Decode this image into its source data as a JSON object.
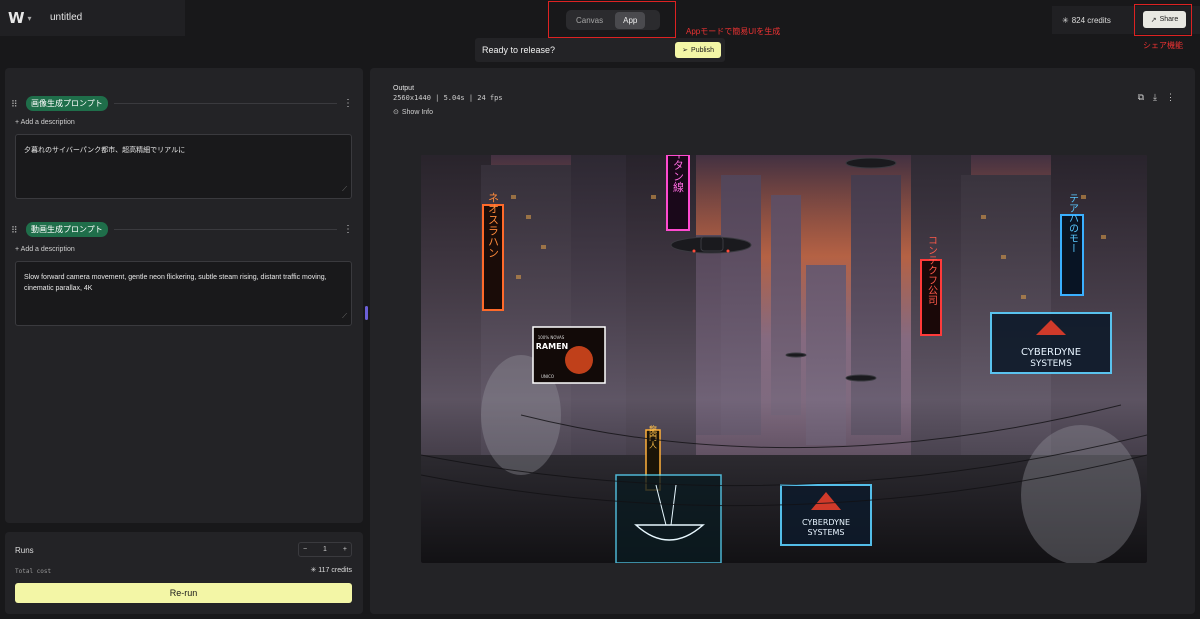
{
  "app": {
    "title": "untitled",
    "logo_icon": "wavy-w-logo-icon"
  },
  "mode_toggle": {
    "tabs": [
      {
        "label": "Canvas",
        "active": false
      },
      {
        "label": "App",
        "active": true
      }
    ]
  },
  "annotations": {
    "app_mode": "Appモードで簡易UIを生成",
    "share": "シェア機能"
  },
  "header": {
    "credits": "824 credits",
    "share_label": "Share"
  },
  "release": {
    "text": "Ready to release?",
    "publish_label": "Publish"
  },
  "nodes": [
    {
      "tag": "画像生成プロンプト",
      "add_description": "+ Add a description",
      "value": "夕暮れのサイバーパンク都市、超高精細でリアルに"
    },
    {
      "tag": "動画生成プロンプト",
      "add_description": "+ Add a description",
      "value": "Slow forward camera movement, gentle neon flickering, subtle steam rising, distant traffic moving, cinematic parallax, 4K"
    }
  ],
  "runs": {
    "label": "Runs",
    "count": "1",
    "minus": "−",
    "plus": "+",
    "total_cost_label": "Total cost",
    "total_cost": "117 credits",
    "rerun_label": "Re-run"
  },
  "output": {
    "label": "Output",
    "meta": "2560x1440 | 5.04s | 24 fps",
    "show_info": "Show Info",
    "image_signs": {
      "ramen_top": "100% NOVAS",
      "ramen": "RAMEN",
      "ramen_bottom": "UNICO",
      "cyberdyne_1": "CYBERDYNE",
      "systems_1": "SYSTEMS",
      "cyberdyne_2": "CYBERDYNE",
      "systems_2": "SYSTEMS",
      "vertical_1": "ネオスラハン",
      "vertical_2": "アイタン線",
      "vertical_3": "コンテクフ公司",
      "vertical_4": "テアハのモー",
      "vertical_5": "龍門人"
    }
  },
  "colors": {
    "accent_yellow": "#f3f6a6",
    "tag_green": "#1f6e4a",
    "annotation_red": "#dd2222",
    "handle_purple": "#6b5fd6"
  }
}
